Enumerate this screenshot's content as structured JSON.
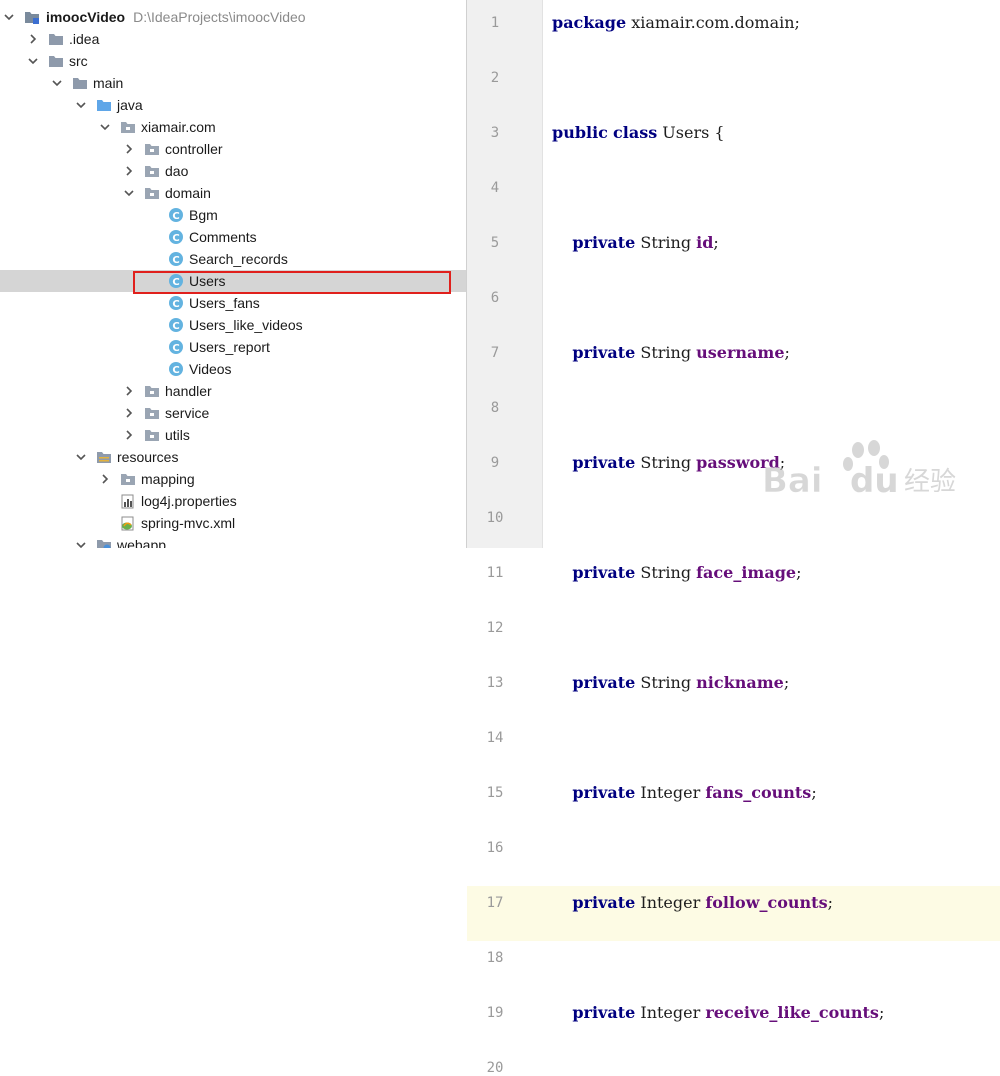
{
  "project_tree": {
    "root": {
      "name": "imoocVideo",
      "path": "D:\\IdeaProjects\\imoocVideo"
    },
    "items": [
      {
        "label": ".idea",
        "depth": 1,
        "arrow": "right",
        "icon": "folder"
      },
      {
        "label": "src",
        "depth": 1,
        "arrow": "down",
        "icon": "folder"
      },
      {
        "label": "main",
        "depth": 2,
        "arrow": "down",
        "icon": "folder"
      },
      {
        "label": "java",
        "depth": 3,
        "arrow": "down",
        "icon": "source-folder"
      },
      {
        "label": "xiamair.com",
        "depth": 4,
        "arrow": "down",
        "icon": "package"
      },
      {
        "label": "controller",
        "depth": 5,
        "arrow": "right",
        "icon": "package"
      },
      {
        "label": "dao",
        "depth": 5,
        "arrow": "right",
        "icon": "package"
      },
      {
        "label": "domain",
        "depth": 5,
        "arrow": "down",
        "icon": "package"
      },
      {
        "label": "Bgm",
        "depth": 6,
        "arrow": "none",
        "icon": "class"
      },
      {
        "label": "Comments",
        "depth": 6,
        "arrow": "none",
        "icon": "class"
      },
      {
        "label": "Search_records",
        "depth": 6,
        "arrow": "none",
        "icon": "class"
      },
      {
        "label": "Users",
        "depth": 6,
        "arrow": "none",
        "icon": "class",
        "selected": true
      },
      {
        "label": "Users_fans",
        "depth": 6,
        "arrow": "none",
        "icon": "class"
      },
      {
        "label": "Users_like_videos",
        "depth": 6,
        "arrow": "none",
        "icon": "class"
      },
      {
        "label": "Users_report",
        "depth": 6,
        "arrow": "none",
        "icon": "class"
      },
      {
        "label": "Videos",
        "depth": 6,
        "arrow": "none",
        "icon": "class"
      },
      {
        "label": "handler",
        "depth": 5,
        "arrow": "right",
        "icon": "package"
      },
      {
        "label": "service",
        "depth": 5,
        "arrow": "right",
        "icon": "package"
      },
      {
        "label": "utils",
        "depth": 5,
        "arrow": "right",
        "icon": "package"
      },
      {
        "label": "resources",
        "depth": 3,
        "arrow": "down",
        "icon": "resources-folder"
      },
      {
        "label": "mapping",
        "depth": 4,
        "arrow": "right",
        "icon": "package"
      },
      {
        "label": "log4j.properties",
        "depth": 4,
        "arrow": "none",
        "icon": "properties-file"
      },
      {
        "label": "spring-mvc.xml",
        "depth": 4,
        "arrow": "none",
        "icon": "xml-file"
      },
      {
        "label": "webapp",
        "depth": 3,
        "arrow": "down",
        "icon": "web-folder"
      }
    ]
  },
  "editor": {
    "current_line": 17,
    "lines": [
      {
        "n": "1",
        "tokens": [
          {
            "t": "package",
            "c": "kw"
          },
          {
            "t": " xiamair.com.domain;",
            "c": ""
          }
        ]
      },
      {
        "n": "2",
        "tokens": []
      },
      {
        "n": "3",
        "tokens": [
          {
            "t": "public",
            "c": "kw"
          },
          {
            "t": " ",
            "c": ""
          },
          {
            "t": "class",
            "c": "kw"
          },
          {
            "t": " Users {",
            "c": ""
          }
        ]
      },
      {
        "n": "4",
        "tokens": []
      },
      {
        "n": "5",
        "tokens": [
          {
            "t": "    ",
            "c": ""
          },
          {
            "t": "private",
            "c": "kw"
          },
          {
            "t": " String ",
            "c": ""
          },
          {
            "t": "id",
            "c": "fld"
          },
          {
            "t": ";",
            "c": ""
          }
        ]
      },
      {
        "n": "6",
        "tokens": []
      },
      {
        "n": "7",
        "tokens": [
          {
            "t": "    ",
            "c": ""
          },
          {
            "t": "private",
            "c": "kw"
          },
          {
            "t": " String ",
            "c": ""
          },
          {
            "t": "username",
            "c": "fld"
          },
          {
            "t": ";",
            "c": ""
          }
        ]
      },
      {
        "n": "8",
        "tokens": []
      },
      {
        "n": "9",
        "tokens": [
          {
            "t": "    ",
            "c": ""
          },
          {
            "t": "private",
            "c": "kw"
          },
          {
            "t": " String ",
            "c": ""
          },
          {
            "t": "password",
            "c": "fld"
          },
          {
            "t": ";",
            "c": ""
          }
        ]
      },
      {
        "n": "10",
        "tokens": []
      },
      {
        "n": "11",
        "tokens": [
          {
            "t": "    ",
            "c": ""
          },
          {
            "t": "private",
            "c": "kw"
          },
          {
            "t": " String ",
            "c": ""
          },
          {
            "t": "face_image",
            "c": "fld"
          },
          {
            "t": ";",
            "c": ""
          }
        ]
      },
      {
        "n": "12",
        "tokens": []
      },
      {
        "n": "13",
        "tokens": [
          {
            "t": "    ",
            "c": ""
          },
          {
            "t": "private",
            "c": "kw"
          },
          {
            "t": " String ",
            "c": ""
          },
          {
            "t": "nickname",
            "c": "fld"
          },
          {
            "t": ";",
            "c": ""
          }
        ]
      },
      {
        "n": "14",
        "tokens": []
      },
      {
        "n": "15",
        "tokens": [
          {
            "t": "    ",
            "c": ""
          },
          {
            "t": "private",
            "c": "kw"
          },
          {
            "t": " Integer ",
            "c": ""
          },
          {
            "t": "fans_counts",
            "c": "fld"
          },
          {
            "t": ";",
            "c": ""
          }
        ]
      },
      {
        "n": "16",
        "tokens": []
      },
      {
        "n": "17",
        "tokens": [
          {
            "t": "    ",
            "c": ""
          },
          {
            "t": "private",
            "c": "kw"
          },
          {
            "t": " Integer ",
            "c": ""
          },
          {
            "t": "follow_counts",
            "c": "fld"
          },
          {
            "t": ";",
            "c": ""
          }
        ]
      },
      {
        "n": "18",
        "tokens": []
      },
      {
        "n": "19",
        "tokens": [
          {
            "t": "    ",
            "c": ""
          },
          {
            "t": "private",
            "c": "kw"
          },
          {
            "t": " Integer ",
            "c": ""
          },
          {
            "t": "receive_like_counts",
            "c": "fld"
          },
          {
            "t": ";",
            "c": ""
          }
        ]
      },
      {
        "n": "20",
        "tokens": []
      }
    ]
  },
  "watermark": {
    "text": "Bai",
    "text2": "du",
    "cn": "经验",
    "icon": "baidu-paw-icon"
  },
  "colors": {
    "keyword": "#000080",
    "field": "#660e7a",
    "highlight_box": "#e0201c",
    "selected_row": "#d5d5d5",
    "current_line": "#fdfbe4"
  }
}
